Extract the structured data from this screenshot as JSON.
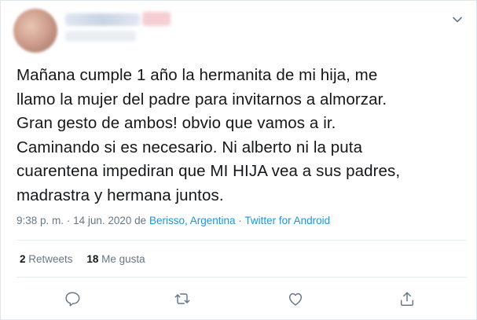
{
  "tweet": {
    "text_lines": [
      "Mañana cumple 1 año la hermanita de mi hija, me",
      "llamo la mujer del padre para invitarnos a almorzar.",
      "Gran gesto de ambos! obvio que vamos a ir.",
      "Caminando si es necesario. Ni alberto ni la puta",
      "cuarentena impediran que MI HIJA vea a sus padres,",
      "madrastra y hermana juntos."
    ],
    "time": "9:38 p. m.",
    "date": "14 jun. 2020",
    "from_word": "de",
    "location": "Berisso, Argentina",
    "separator": "·",
    "source": "Twitter for Android"
  },
  "stats": {
    "retweets_count": "2",
    "retweets_label": "Retweets",
    "likes_count": "18",
    "likes_label": "Me gusta"
  },
  "icons": {
    "caret": "chevron-down-icon",
    "reply": "reply-icon",
    "retweet": "retweet-icon",
    "like": "heart-icon",
    "share": "share-icon"
  },
  "colors": {
    "text": "#14171a",
    "secondary": "#657786",
    "link": "#1b95e0",
    "divider": "#e6ecf0"
  }
}
